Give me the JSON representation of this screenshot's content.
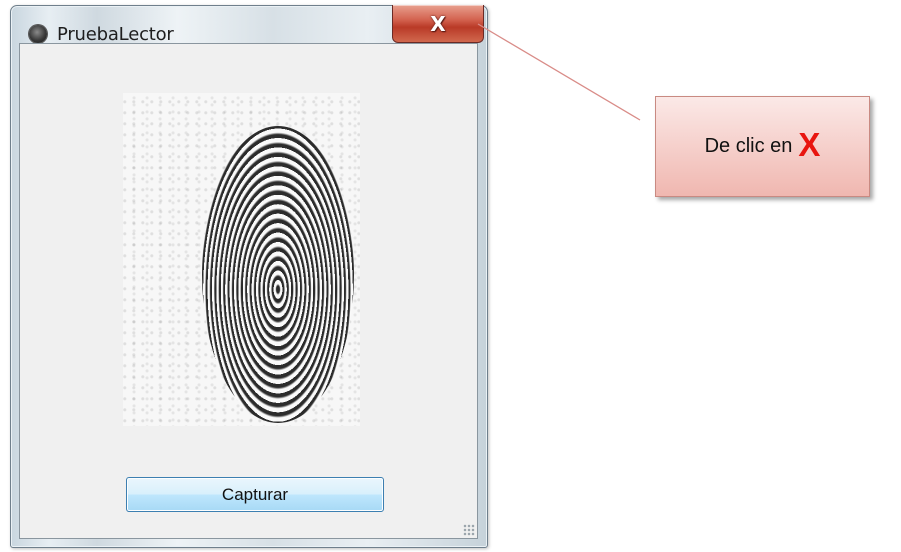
{
  "window": {
    "title": "PruebaLector",
    "close_glyph": "X",
    "icon": "app-orb-icon"
  },
  "main": {
    "image": {
      "content": "fingerprint-image"
    },
    "capture_label": "Capturar"
  },
  "callout": {
    "text": "De clic en",
    "emphasis": "X",
    "emphasis_color": "#e8150f"
  },
  "colors": {
    "close_button": "#c8412d",
    "callout_bg": "#f0b7b0",
    "button_border": "#3c7fb1"
  }
}
